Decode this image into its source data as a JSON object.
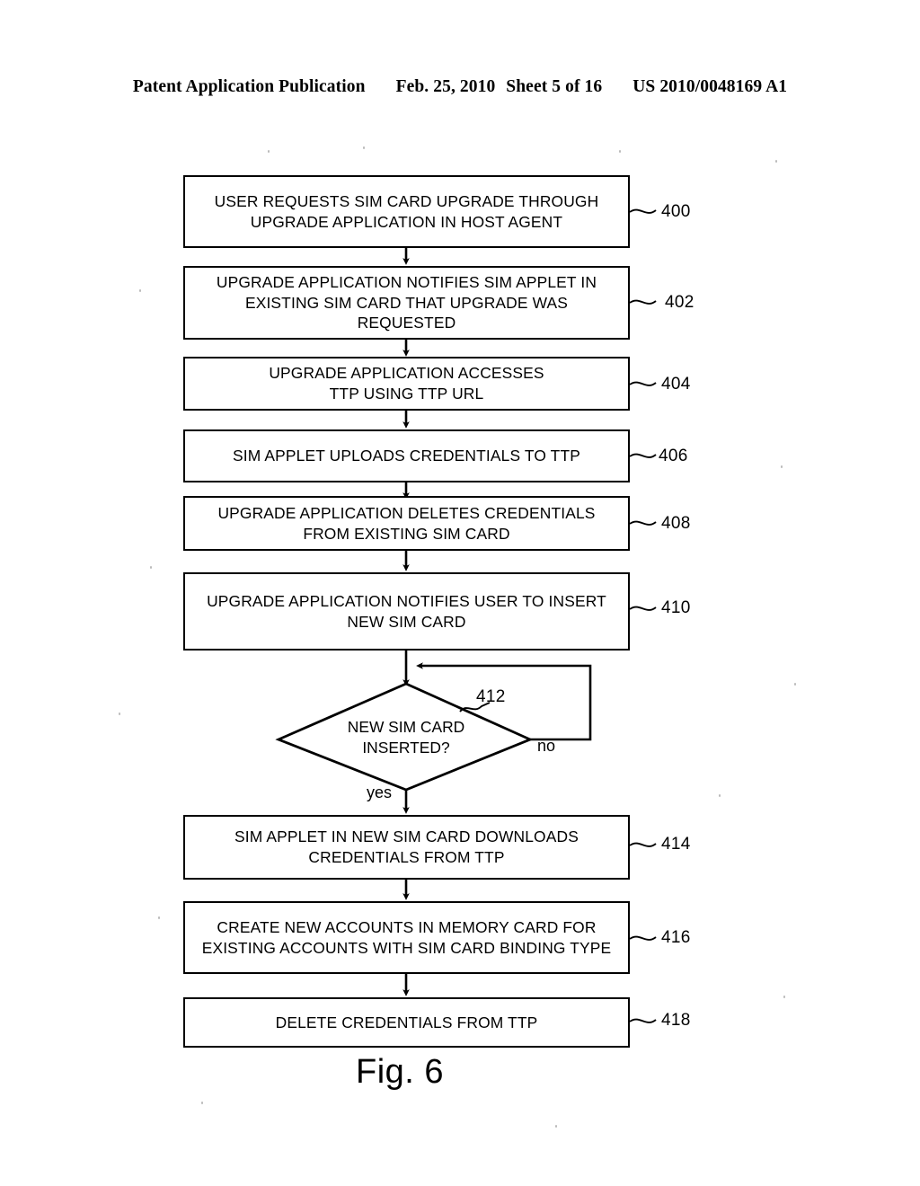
{
  "header": {
    "publication": "Patent Application Publication",
    "date": "Feb. 25, 2010",
    "sheet": "Sheet 5 of 16",
    "patent_number": "US 2010/0048169 A1"
  },
  "figure": {
    "caption": "Fig. 6",
    "type": "flowchart"
  },
  "flowchart": {
    "nodes": [
      {
        "ref": "400",
        "shape": "process",
        "text": "USER REQUESTS SIM CARD UPGRADE THROUGH\nUPGRADE APPLICATION IN HOST AGENT"
      },
      {
        "ref": "402",
        "shape": "process",
        "text": "UPGRADE APPLICATION NOTIFIES SIM APPLET IN\nEXISTING SIM CARD THAT UPGRADE WAS\nREQUESTED"
      },
      {
        "ref": "404",
        "shape": "process",
        "text": "UPGRADE APPLICATION ACCESSES\nTTP USING TTP URL"
      },
      {
        "ref": "406",
        "shape": "process",
        "text": "SIM APPLET UPLOADS CREDENTIALS TO TTP"
      },
      {
        "ref": "408",
        "shape": "process",
        "text": "UPGRADE APPLICATION DELETES CREDENTIALS\nFROM EXISTING SIM CARD"
      },
      {
        "ref": "410",
        "shape": "process",
        "text": "UPGRADE APPLICATION NOTIFIES USER TO INSERT\nNEW SIM CARD"
      },
      {
        "ref": "412",
        "shape": "decision",
        "text": "NEW SIM CARD\nINSERTED?"
      },
      {
        "ref": "414",
        "shape": "process",
        "text": "SIM APPLET IN NEW SIM CARD DOWNLOADS\nCREDENTIALS FROM TTP"
      },
      {
        "ref": "416",
        "shape": "process",
        "text": "CREATE NEW ACCOUNTS IN MEMORY CARD FOR\nEXISTING ACCOUNTS WITH SIM CARD BINDING TYPE"
      },
      {
        "ref": "418",
        "shape": "process",
        "text": "DELETE CREDENTIALS FROM TTP"
      }
    ],
    "branch_labels": {
      "yes": "yes",
      "no": "no"
    }
  },
  "colors": {
    "ink": "#000000",
    "paper": "#ffffff"
  }
}
